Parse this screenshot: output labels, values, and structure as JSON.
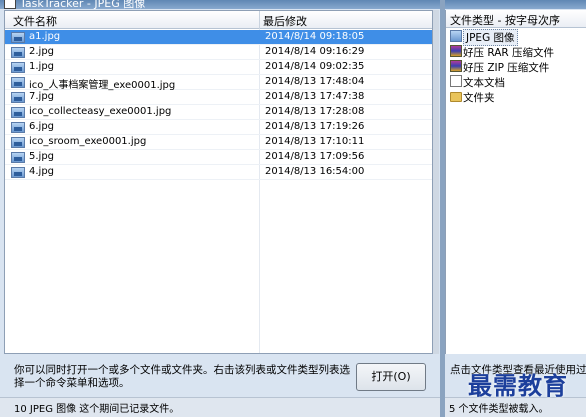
{
  "window": {
    "title": "TaskTracker - JPEG 图像"
  },
  "file_list": {
    "columns": [
      "文件名称",
      "最后修改"
    ],
    "rows": [
      {
        "name": "a1.jpg",
        "modified": "2014/8/14 09:18:05",
        "selected": true
      },
      {
        "name": "2.jpg",
        "modified": "2014/8/14 09:16:29"
      },
      {
        "name": "1.jpg",
        "modified": "2014/8/14 09:02:35"
      },
      {
        "name": "ico_人事档案管理_exe0001.jpg",
        "modified": "2014/8/13 17:48:04"
      },
      {
        "name": "7.jpg",
        "modified": "2014/8/13 17:47:38"
      },
      {
        "name": "ico_collecteasy_exe0001.jpg",
        "modified": "2014/8/13 17:28:08"
      },
      {
        "name": "6.jpg",
        "modified": "2014/8/13 17:19:26"
      },
      {
        "name": "ico_sroom_exe0001.jpg",
        "modified": "2014/8/13 17:10:11"
      },
      {
        "name": "5.jpg",
        "modified": "2014/8/13 17:09:56"
      },
      {
        "name": "4.jpg",
        "modified": "2014/8/13 16:54:00"
      }
    ]
  },
  "hint": {
    "text": "你可以同时打开一个或多个文件或文件夹。右击该列表或文件类型列表选择一个命令菜单和选项。"
  },
  "buttons": {
    "open_label": "打开(O)"
  },
  "status": {
    "left": "10 JPEG 图像 这个期间已记录文件。",
    "right": "5 个文件类型被载入。"
  },
  "type_panel": {
    "header": "文件类型 - 按字母次序",
    "items": [
      {
        "label": "JPEG 图像",
        "icon": "jpeg-image-icon"
      },
      {
        "label": "好压 RAR 压缩文件",
        "icon": "rar-archive-icon"
      },
      {
        "label": "好压 ZIP 压缩文件",
        "icon": "zip-archive-icon"
      },
      {
        "label": "文本文档",
        "icon": "text-document-icon"
      },
      {
        "label": "文件夹",
        "icon": "folder-icon"
      }
    ],
    "hint": "点击文件类型查看最近使用过的..."
  },
  "watermark": {
    "text": "最需教育"
  },
  "colors": {
    "selection": "#3f8ee7",
    "window_frame": "#8aa3c0"
  }
}
